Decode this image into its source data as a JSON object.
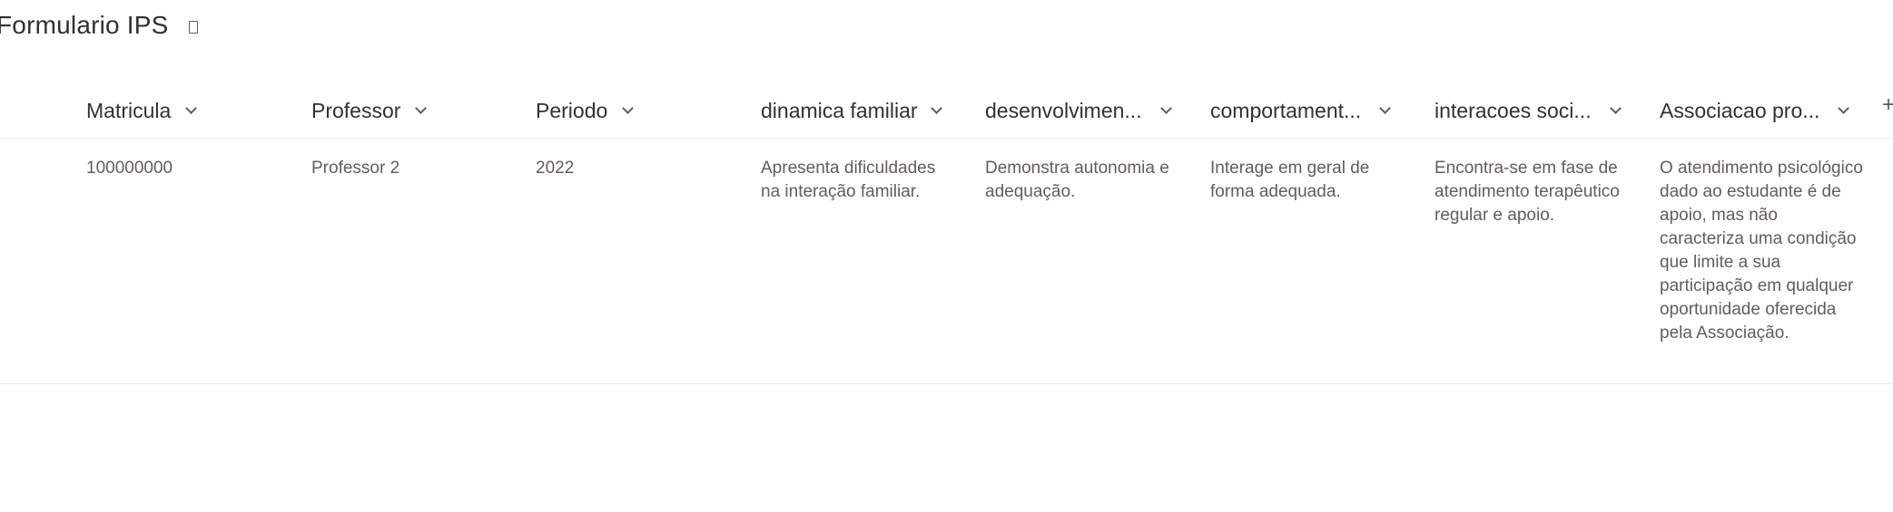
{
  "page": {
    "title": "Formulario IPS",
    "icon": "document-icon"
  },
  "columns": [
    {
      "label": "Matricula",
      "icon": "chevron-down-icon"
    },
    {
      "label": "Professor",
      "icon": "chevron-down-icon"
    },
    {
      "label": "Periodo",
      "icon": "chevron-down-icon"
    },
    {
      "label": "dinamica familiar",
      "icon": "chevron-down-icon"
    },
    {
      "label": "desenvolvimen...",
      "icon": "chevron-down-icon"
    },
    {
      "label": "comportament...",
      "icon": "chevron-down-icon"
    },
    {
      "label": "interacoes soci...",
      "icon": "chevron-down-icon"
    },
    {
      "label": "Associacao pro...",
      "icon": "chevron-down-icon"
    }
  ],
  "add_column": {
    "label": "+"
  },
  "rows": [
    {
      "cells": [
        "100000000",
        "Professor 2",
        "2022",
        "Apresenta dificuldades na interação familiar.",
        "Demonstra autonomia e adequação.",
        "Interage em geral de forma adequada.",
        "Encontra-se em fase de atendimento terapêutico regular e apoio.",
        "O atendimento psicológico dado ao estudante é de apoio, mas não caracteriza uma condição que limite a sua participação em qualquer oportunidade oferecida pela Associação."
      ]
    }
  ]
}
